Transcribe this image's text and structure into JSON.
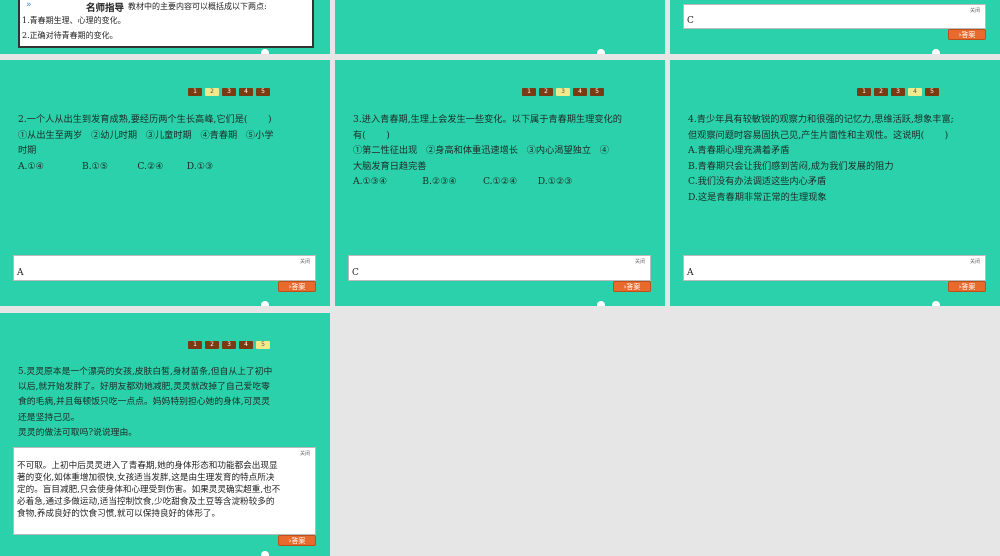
{
  "top": {
    "left": {
      "header_title": "名师指导",
      "header_desc": "教材中的主要内容可以概括成以下两点:",
      "items": [
        "1.青春期生理、心理的变化。",
        "2.正确对待青春期的变化。"
      ]
    },
    "right": {
      "close": "关闭",
      "answer": "C",
      "button": "答案"
    }
  },
  "nav": [
    "1",
    "2",
    "3",
    "4",
    "5"
  ],
  "questions": [
    {
      "lines": [
        "2.一个人从出生到发育成熟,要经历两个生长高峰,它们是(       )",
        "①从出生至两岁   ②幼儿时期   ③儿童时期   ④青春期   ⑤小学",
        "时期",
        "A.①④             B.①⑤          C.②④        D.①③"
      ],
      "close": "关闭",
      "answer": "A",
      "button": "答案"
    },
    {
      "lines": [
        "3.进入青春期,生理上会发生一些变化。以下属于青春期生理变化的",
        "有(       )",
        "①第二性征出现   ②身高和体重迅速增长   ③内心渴望独立   ④",
        "大脑发育日趋完善",
        "A.①③④            B.②③④         C.①②④       D.①②③"
      ],
      "close": "关闭",
      "answer": "C",
      "button": "答案"
    },
    {
      "lines": [
        "4.青少年具有较敏锐的观察力和很强的记忆力,思维活跃,想象丰富;",
        "但观察问题时容易固执己见,产生片面性和主观性。这说明(       )",
        "A.青春期心理充满着矛盾",
        "B.青春期只会让我们感到苦闷,成为我们发展的阻力",
        "C.我们没有办法调适这些内心矛盾",
        "D.这是青春期非常正常的生理现象"
      ],
      "close": "关闭",
      "answer": "A",
      "button": "答案"
    },
    {
      "lines": [
        "5.灵灵原本是一个漂亮的女孩,皮肤白皙,身材苗条,但自从上了初中",
        "以后,就开始发胖了。好朋友都劝她减肥,灵灵就改掉了自己爱吃零",
        "食的毛病,并且每顿饭只吃一点点。妈妈特别担心她的身体,可灵灵",
        "还是坚持己见。",
        "灵灵的做法可取吗?说说理由。"
      ],
      "close": "关闭",
      "answer_lines": [
        "不可取。上初中后灵灵进入了青春期,她的身体形态和功能都会出现显",
        "著的变化,如体重增加很快,女孩适当发胖,这是由生理发育的特点所决",
        "定的。盲目减肥,只会使身体和心理受到伤害。如果灵灵确实超重,也不",
        "必着急,通过多做运动,适当控制饮食,少吃甜食及土豆等含淀粉较多的",
        "食物,养成良好的饮食习惯,就可以保持良好的体形了。"
      ],
      "button": "答案"
    }
  ]
}
